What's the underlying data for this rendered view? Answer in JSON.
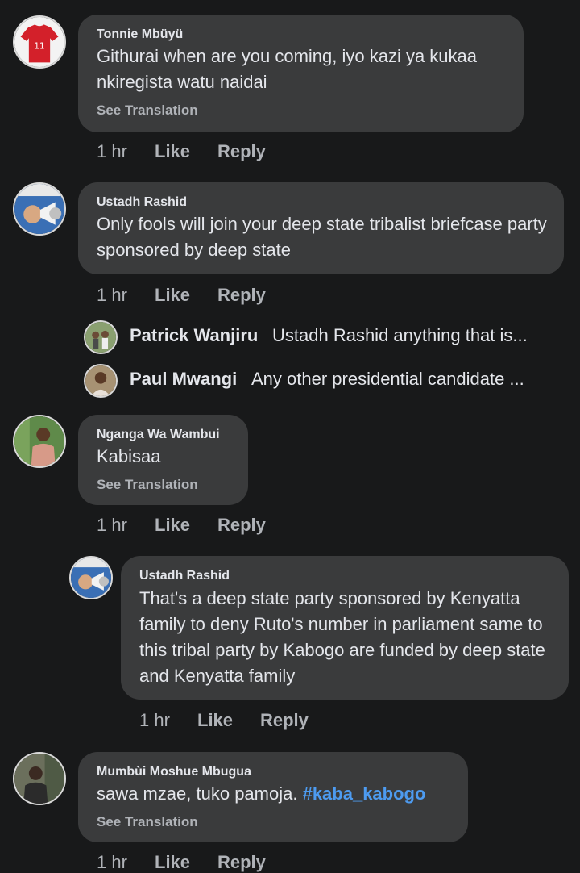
{
  "comments": [
    {
      "author": "Tonnie Mbüyü",
      "text": "Githurai when are you coming, iyo kazi ya kukaa nkiregista watu naidai",
      "translation": "See Translation",
      "time": "1 hr",
      "like": "Like",
      "reply": "Reply",
      "avatar_icon": "football-jersey-avatar"
    },
    {
      "author": "Ustadh Rashid",
      "text": "Only fools will join your deep state tribalist briefcase party sponsored by deep state",
      "time": "1 hr",
      "like": "Like",
      "reply": "Reply",
      "avatar_icon": "megaphone-avatar"
    },
    {
      "author": "Nganga Wa Wambui",
      "text": "Kabisaa",
      "translation": "See Translation",
      "time": "1 hr",
      "like": "Like",
      "reply": "Reply",
      "avatar_icon": "person-avatar"
    },
    {
      "author": "Ustadh Rashid",
      "text": "That's a deep state party sponsored by Kenyatta family to deny Ruto's number in parliament same to this tribal party by Kabogo are funded by deep state and Kenyatta family",
      "time": "1 hr",
      "like": "Like",
      "reply": "Reply",
      "avatar_icon": "megaphone-avatar"
    },
    {
      "author": "Mumbùi Moshue Mbugua",
      "text": "sawa mzae, tuko pamoja. ",
      "hashtag": "#kaba_kabogo",
      "translation": "See Translation",
      "time": "1 hr",
      "like": "Like",
      "reply": "Reply",
      "avatar_icon": "person-avatar"
    }
  ],
  "replies": [
    {
      "author": "Patrick Wanjiru",
      "preview": "Ustadh Rashid anything that is..."
    },
    {
      "author": "Paul Mwangi",
      "preview": "Any other presidential candidate ..."
    }
  ],
  "colors": {
    "background": "#18191a",
    "bubble": "#3a3b3c",
    "text": "#e4e6eb",
    "muted": "#b0b3b8",
    "hashtag": "#4d9bf0"
  }
}
